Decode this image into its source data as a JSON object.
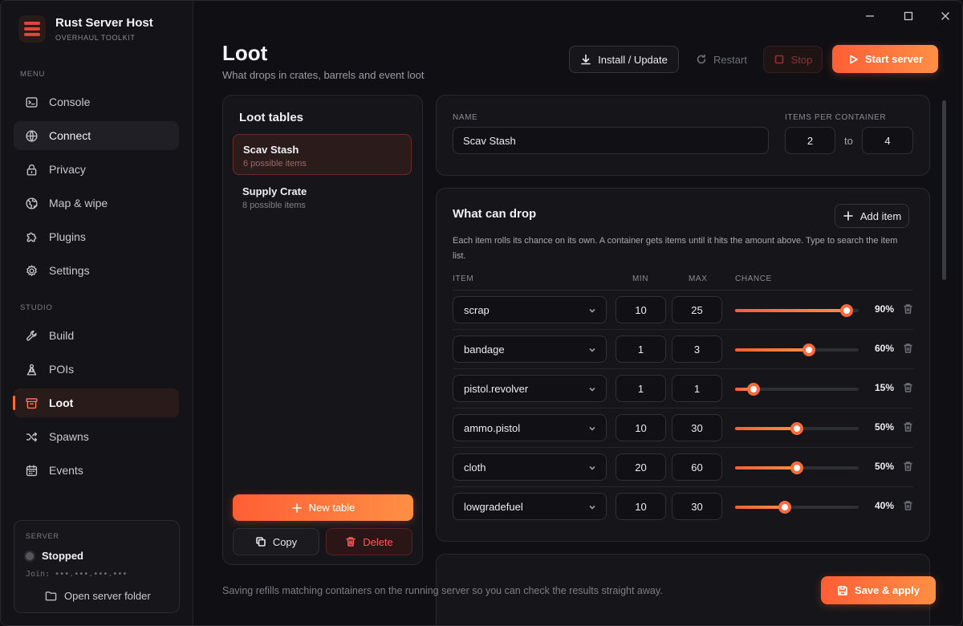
{
  "brand": {
    "title": "Rust Server Host",
    "subtitle": "OVERHAUL TOOLKIT"
  },
  "sidebar": {
    "menu_label": "MENU",
    "studio_label": "STUDIO",
    "menu_items": [
      {
        "label": "Console",
        "icon": "console-icon"
      },
      {
        "label": "Connect",
        "icon": "globe-icon"
      },
      {
        "label": "Privacy",
        "icon": "lock-icon"
      },
      {
        "label": "Map & wipe",
        "icon": "map-globe-icon"
      },
      {
        "label": "Plugins",
        "icon": "puzzle-icon"
      },
      {
        "label": "Settings",
        "icon": "gear-icon"
      }
    ],
    "studio_items": [
      {
        "label": "Build",
        "icon": "wrench-icon"
      },
      {
        "label": "POIs",
        "icon": "person-pin-icon"
      },
      {
        "label": "Loot",
        "icon": "crate-icon"
      },
      {
        "label": "Spawns",
        "icon": "shuffle-icon"
      },
      {
        "label": "Events",
        "icon": "calendar-icon"
      }
    ],
    "active": "Loot",
    "hovered": "Connect"
  },
  "server": {
    "label": "SERVER",
    "status": "Stopped",
    "join": "Join: •••.•••.•••.•••",
    "open_folder": "Open server folder"
  },
  "header": {
    "title": "Loot",
    "subtitle": "What drops in crates, barrels and event loot",
    "install_label": "Install / Update",
    "restart_label": "Restart",
    "stop_label": "Stop",
    "start_label": "Start server"
  },
  "loot_tables": {
    "title": "Loot tables",
    "items": [
      {
        "name": "Scav Stash",
        "count": "6 possible items",
        "selected": true
      },
      {
        "name": "Supply Crate",
        "count": "8 possible items",
        "selected": false
      }
    ],
    "new_label": "New table",
    "copy_label": "Copy",
    "delete_label": "Delete"
  },
  "editor": {
    "name_label": "NAME",
    "name_value": "Scav Stash",
    "per_container_label": "ITEMS PER CONTAINER",
    "min_items": "2",
    "to_label": "to",
    "max_items": "4"
  },
  "drops": {
    "title": "What can drop",
    "add_label": "Add item",
    "description": "Each item rolls its chance on its own. A container gets items until it hits the amount above. Type to search the item list.",
    "columns": {
      "item": "ITEM",
      "min": "MIN",
      "max": "MAX",
      "chance": "CHANCE"
    },
    "rows": [
      {
        "item": "scrap",
        "min": "10",
        "max": "25",
        "chance": 90,
        "chance_label": "90%"
      },
      {
        "item": "bandage",
        "min": "1",
        "max": "3",
        "chance": 60,
        "chance_label": "60%"
      },
      {
        "item": "pistol.revolver",
        "min": "1",
        "max": "1",
        "chance": 15,
        "chance_label": "15%"
      },
      {
        "item": "ammo.pistol",
        "min": "10",
        "max": "30",
        "chance": 50,
        "chance_label": "50%"
      },
      {
        "item": "cloth",
        "min": "20",
        "max": "60",
        "chance": 50,
        "chance_label": "50%"
      },
      {
        "item": "lowgradefuel",
        "min": "10",
        "max": "30",
        "chance": 40,
        "chance_label": "40%"
      }
    ]
  },
  "footer": {
    "note": "Saving refills matching containers on the running server so you can check the results straight away.",
    "save_label": "Save & apply"
  },
  "colors": {
    "accent": "#ff6a3d",
    "accent_end": "#ff8f44",
    "danger": "#ff5a5a",
    "bg": "#101014"
  }
}
